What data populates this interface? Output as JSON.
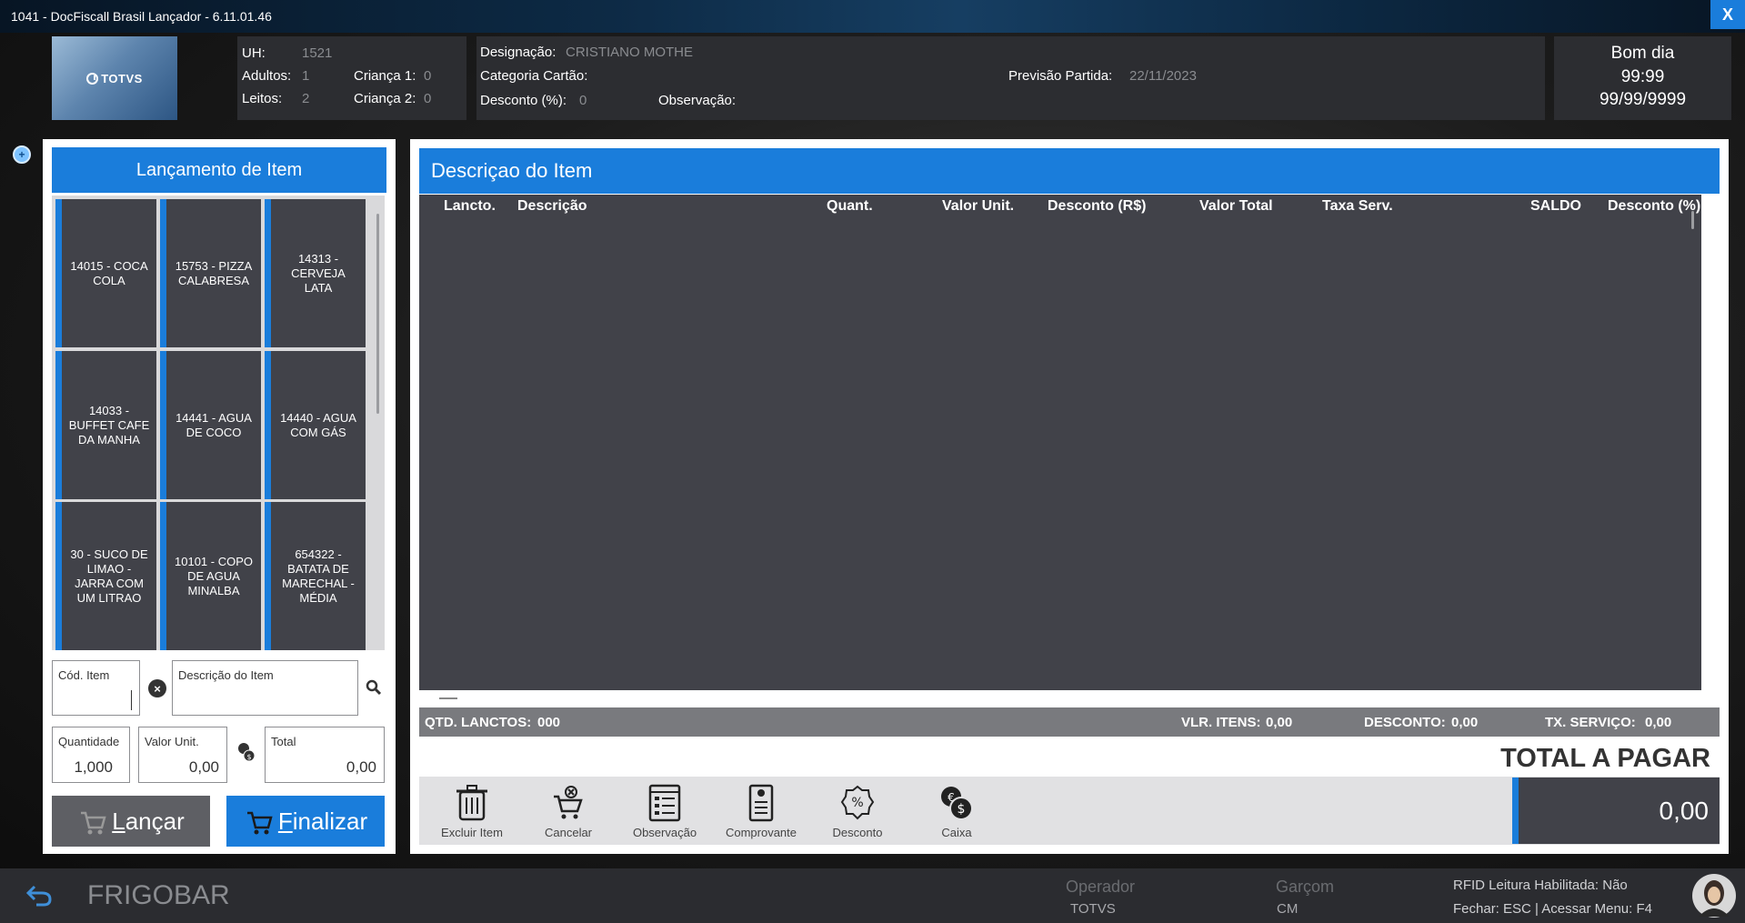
{
  "window": {
    "title": "1041 - DocFiscall Brasil Lançador - 6.11.01.46",
    "close_label": "X"
  },
  "logo": {
    "text": "TOTVS"
  },
  "guest": {
    "uh_label": "UH:",
    "uh_value": "1521",
    "adultos_label": "Adultos:",
    "adultos_value": "1",
    "crianca1_label": "Criança 1:",
    "crianca1_value": "0",
    "leitos_label": "Leitos:",
    "leitos_value": "2",
    "crianca2_label": "Criança 2:",
    "crianca2_value": "0"
  },
  "details": {
    "designacao_label": "Designação:",
    "designacao_value": "CRISTIANO MOTHE",
    "categoria_label": "Categoria Cartão:",
    "previsao_label": "Previsão Partida:",
    "previsao_value": "22/11/2023",
    "desconto_label": "Desconto (%):",
    "desconto_value": "0",
    "observacao_label": "Observação:"
  },
  "greeting": {
    "text": "Bom dia",
    "time": "99:99",
    "date": "99/99/9999"
  },
  "left_panel": {
    "title": "Lançamento de Item",
    "tiles": [
      "14015 - COCA COLA",
      "15753 - PIZZA CALABRESA",
      "14313 - CERVEJA LATA",
      "14033 - BUFFET CAFE DA MANHA",
      "14441 - AGUA DE COCO",
      "14440 - AGUA COM GÁS",
      "30 - SUCO DE LIMAO - JARRA COM UM LITRAO",
      "10101 - COPO DE AGUA MINALBA",
      "654322 - BATATA DE MARECHAL - MÉDIA"
    ],
    "cod_item_label": "Cód. Item",
    "descricao_label": "Descrição do Item",
    "quantidade_label": "Quantidade",
    "quantidade_value": "1,000",
    "valor_unit_label": "Valor Unit.",
    "valor_unit_value": "0,00",
    "total_label": "Total",
    "total_value": "0,00",
    "lancar_label": "ançar",
    "lancar_key": "L",
    "finalizar_label": "inalizar",
    "finalizar_key": "F"
  },
  "right_panel": {
    "title": "Descriçao do Item",
    "columns": [
      "Lancto.",
      "Descrição",
      "Quant.",
      "Valor Unit.",
      "Desconto (R$)",
      "Valor Total",
      "Taxa Serv.",
      "SALDO",
      "Desconto (%)"
    ],
    "summary": {
      "qtd_label": "QTD. LANCTOS:",
      "qtd_value": "000",
      "vlr_label": "VLR. ITENS:",
      "vlr_value": "0,00",
      "desc_label": "DESCONTO:",
      "desc_value": "0,00",
      "tx_label": "TX. SERVIÇO:",
      "tx_value": "0,00"
    },
    "total_pagar_label": "TOTAL A PAGAR",
    "total_pagar_value": "0,00",
    "tools": [
      "Excluir Item",
      "Cancelar",
      "Observação",
      "Comprovante",
      "Desconto",
      "Caixa"
    ]
  },
  "footer": {
    "back_icon": "back-arrow-icon",
    "section": "FRIGOBAR",
    "operador_label": "Operador",
    "operador_value": "TOTVS",
    "garcom_label": "Garçom",
    "garcom_value": "CM",
    "rfid_text": "RFID Leitura Habilitada: Não",
    "shortcut_text": "Fechar: ESC | Acessar Menu: F4"
  },
  "colors": {
    "accent": "#1a7ddb",
    "tile": "#414249",
    "panel_dark": "#2c2d31"
  }
}
